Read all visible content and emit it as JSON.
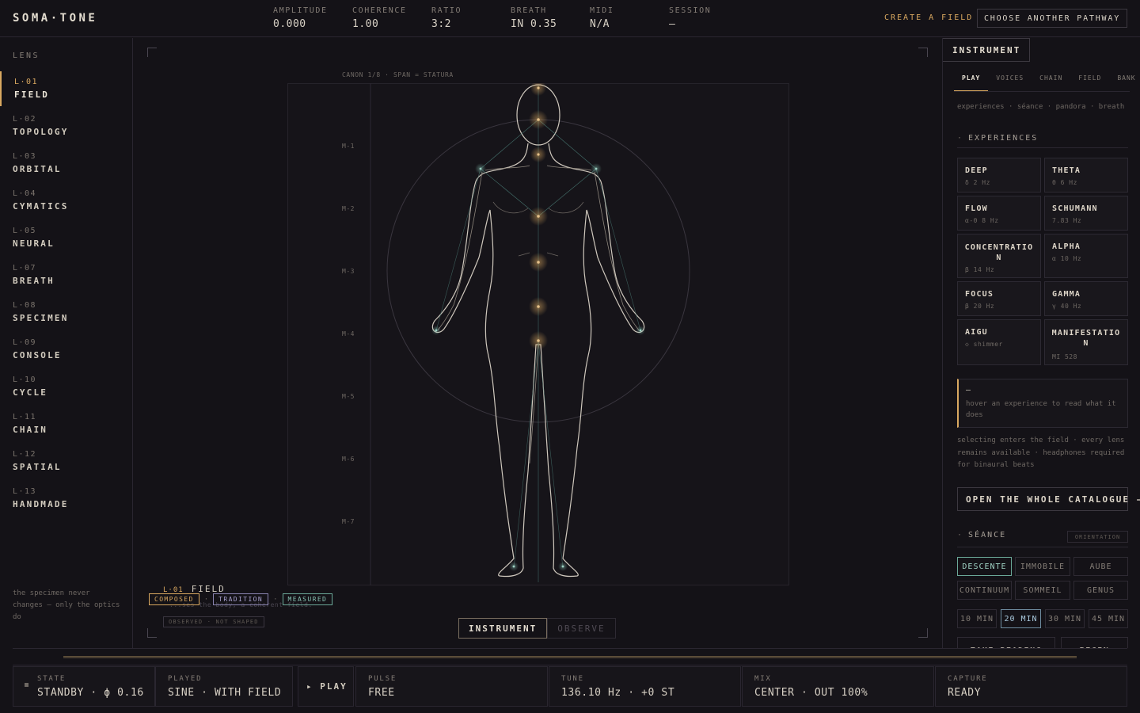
{
  "brand": "SOMA·TONE",
  "topbar": {
    "metrics": [
      {
        "label": "AMPLITUDE",
        "value": "0.000"
      },
      {
        "label": "COHERENCE",
        "value": "1.00"
      },
      {
        "label": "RATIO",
        "value": "3:2"
      },
      {
        "label": "BREATH",
        "value": "IN 0.35"
      },
      {
        "label": "MIDI",
        "value": "N/A"
      },
      {
        "label": "SESSION",
        "value": "—"
      }
    ],
    "create_field": "CREATE A FIELD",
    "choose_pathway": "CHOOSE ANOTHER PATHWAY"
  },
  "sidebar": {
    "title": "LENS",
    "items": [
      {
        "code": "L·01",
        "name": "FIELD",
        "active": true
      },
      {
        "code": "L·02",
        "name": "TOPOLOGY"
      },
      {
        "code": "L·03",
        "name": "ORBITAL"
      },
      {
        "code": "L·04",
        "name": "CYMATICS"
      },
      {
        "code": "L·05",
        "name": "NEURAL"
      },
      {
        "code": "L·07",
        "name": "BREATH"
      },
      {
        "code": "L·08",
        "name": "SPECIMEN"
      },
      {
        "code": "L·09",
        "name": "CONSOLE"
      },
      {
        "code": "L·10",
        "name": "CYCLE"
      },
      {
        "code": "L·11",
        "name": "CHAIN"
      },
      {
        "code": "L·12",
        "name": "SPATIAL"
      },
      {
        "code": "L·13",
        "name": "HANDMADE"
      }
    ],
    "note": "the specimen never changes — only the optics do"
  },
  "stage": {
    "canon_label": "CANON 1/8 · SPAN = STATURA",
    "modules": [
      "M-1",
      "M-2",
      "M-3",
      "M-4",
      "M-5",
      "M-6",
      "M-7"
    ],
    "caption_code": "L·01",
    "caption_name": "FIELD",
    "badges": [
      "COMPOSED",
      "TRADITION",
      "MEASURED"
    ],
    "badge_sep": "·",
    "ghost_text": "...ses the body, a coherent field.",
    "observed_tag": "OBSERVED · NOT SHAPED",
    "modes": [
      "INSTRUMENT",
      "OBSERVE"
    ]
  },
  "panel": {
    "title": "INSTRUMENT",
    "tabs": [
      "PLAY",
      "VOICES",
      "CHAIN",
      "FIELD",
      "BANK"
    ],
    "tab_desc": "experiences · séance · pandora · breath",
    "experiences_head": "EXPERIENCES",
    "experiences": [
      {
        "name": "DEEP",
        "freq": "δ 2 Hz"
      },
      {
        "name": "THETA",
        "freq": "θ 6 Hz"
      },
      {
        "name": "FLOW",
        "freq": "α-θ 8 Hz"
      },
      {
        "name": "SCHUMANN",
        "freq": "7.83 Hz"
      },
      {
        "name": "CONCENTRATION",
        "freq": "β 14 Hz"
      },
      {
        "name": "ALPHA",
        "freq": "α 10 Hz"
      },
      {
        "name": "FOCUS",
        "freq": "β 20 Hz"
      },
      {
        "name": "GAMMA",
        "freq": "γ 40 Hz"
      },
      {
        "name": "AIGU",
        "freq": "◇ shimmer"
      },
      {
        "name": "MANIFESTATION",
        "freq": "MI 528"
      }
    ],
    "hover_dash": "—",
    "hover_text": "hover an experience to read what it does",
    "select_note": "selecting enters the field · every lens remains available · headphones required for binaural beats",
    "catalogue_btn": "OPEN THE WHOLE CATALOGUE →",
    "seance_head": "SÉANCE",
    "orientation": "ORIENTATION",
    "seance_options": [
      "DESCENTE",
      "IMMOBILE",
      "AUBE",
      "CONTINUUM",
      "SOMMEIL",
      "GENUS"
    ],
    "durations": [
      "10 MIN",
      "20 MIN",
      "30 MIN",
      "45 MIN"
    ],
    "take_reading": "TAKE READING",
    "begin": "BEGIN"
  },
  "statusbar": {
    "state_label": "STATE",
    "state_value": "STANDBY · ϕ 0.16",
    "played_label": "PLAYED",
    "played_value": "SINE · WITH FIELD",
    "play_btn": "▸ PLAY",
    "pulse_label": "PULSE",
    "pulse_value": "FREE",
    "tune_label": "TUNE",
    "tune_value": "136.10 Hz · +0 ST",
    "mix_label": "MIX",
    "mix_value": "CENTER · OUT 100%",
    "capture_label": "CAPTURE",
    "capture_value": "READY"
  },
  "colors": {
    "accent": "#d9a860",
    "measured": "#88c4b4",
    "tradition": "#a9a2cf",
    "background": "#141217"
  }
}
